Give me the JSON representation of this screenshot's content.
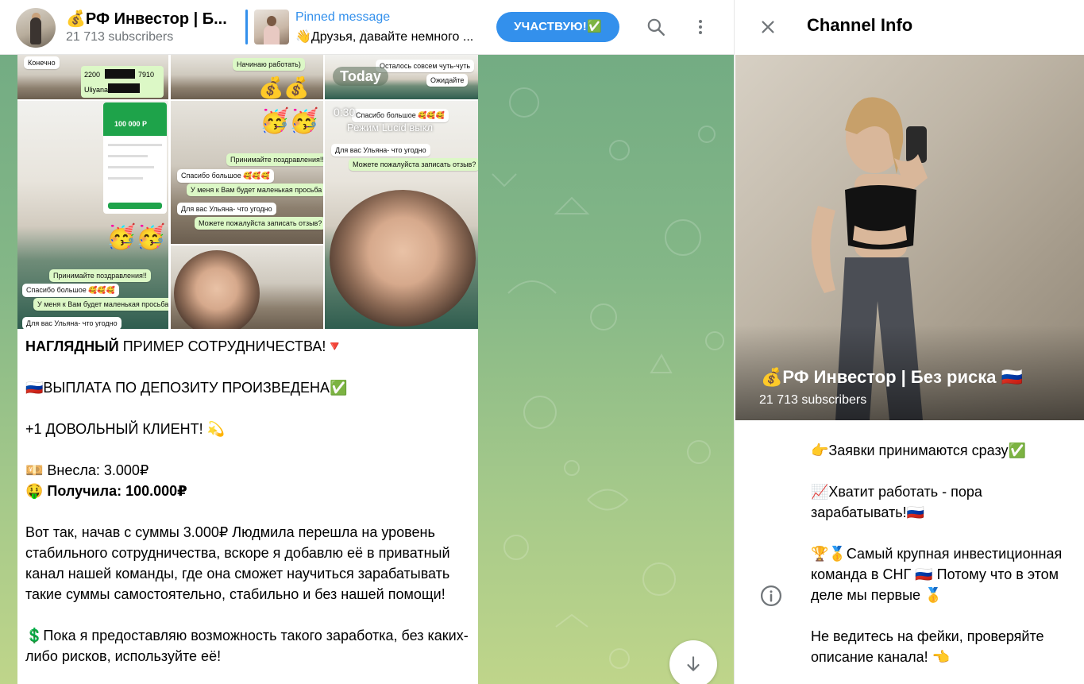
{
  "header": {
    "channel_title": "💰РФ Инвестор | Б...",
    "subscribers": "21 713 subscribers",
    "pinned_label": "Pinned message",
    "pinned_text": "👋Друзья, давайте немного ...",
    "join_button": "УЧАСТВУЮ!✅",
    "icons": {
      "search": "search-icon",
      "menu": "more-vertical-icon"
    }
  },
  "chat": {
    "date_badge": "Today",
    "media_overlay": {
      "time": "0:30",
      "mode_text": "Режим Lucid выкл"
    },
    "screenshot_bubbles": [
      "Конечно",
      "Начинаю работать)",
      "Осталось совсем чуть-чуть",
      "Ожидайте",
      "Спасибо большое 🥰🥰🥰",
      "Принимайте поздравления!!",
      "У меня к Вам будет маленькая просьба",
      "Для вас Ульяна- что угодно",
      "Можете пожалуйста записать отзыв?"
    ],
    "card_labels": [
      "2200",
      "7910",
      "Uliyana",
      "100 000 Р"
    ],
    "message": {
      "line1_bold": "НАГЛЯДНЫЙ",
      "line1_rest": " ПРИМЕР СОТРУДНИЧЕСТВА!🔻",
      "line2": "🇷🇺ВЫПЛАТА ПО ДЕПОЗИТУ ПРОИЗВЕДЕНА✅",
      "line3": "+1 ДОВОЛЬНЫЙ КЛИЕНТ! 💫",
      "deposit": "💴 Внесла: 3.000₽",
      "received_prefix": "🤑 ",
      "received_bold": "Получила: 100.000₽",
      "paragraph": "Вот так, начав с суммы 3.000₽ Людмила перешла на уровень стабильного сотрудничества, вскоре я добавлю её в приватный канал нашей команды, где она сможет научиться зарабатывать такие суммы самостоятельно, стабильно и без нашей помощи!",
      "last": "💲Пока я предоставляю возможность такого заработка, без каких-либо рисков, используйте её!"
    },
    "scroll_down": "arrow-down-icon"
  },
  "info_panel": {
    "title": "Channel Info",
    "channel_name": "💰РФ Инвестор | Без риска 🇷🇺",
    "subscribers": "21 713 subscribers",
    "about": [
      "👉Заявки принимаются сразу✅",
      "📈Хватит работать - пора зарабатывать!🇷🇺",
      "🏆🥇Самый крупная инвестиционная команда в СНГ 🇷🇺 Потому что в этом деле мы первые 🥇",
      "Не ведитесь на фейки, проверяйте описание канала! 👈"
    ],
    "icons": {
      "close": "close-icon",
      "about": "info-icon"
    }
  },
  "colors": {
    "accent": "#3390ec",
    "bubble_green": "#dcf8c6",
    "chat_bg_top": "#73ac83",
    "chat_bg_bottom": "#bfd58a"
  }
}
